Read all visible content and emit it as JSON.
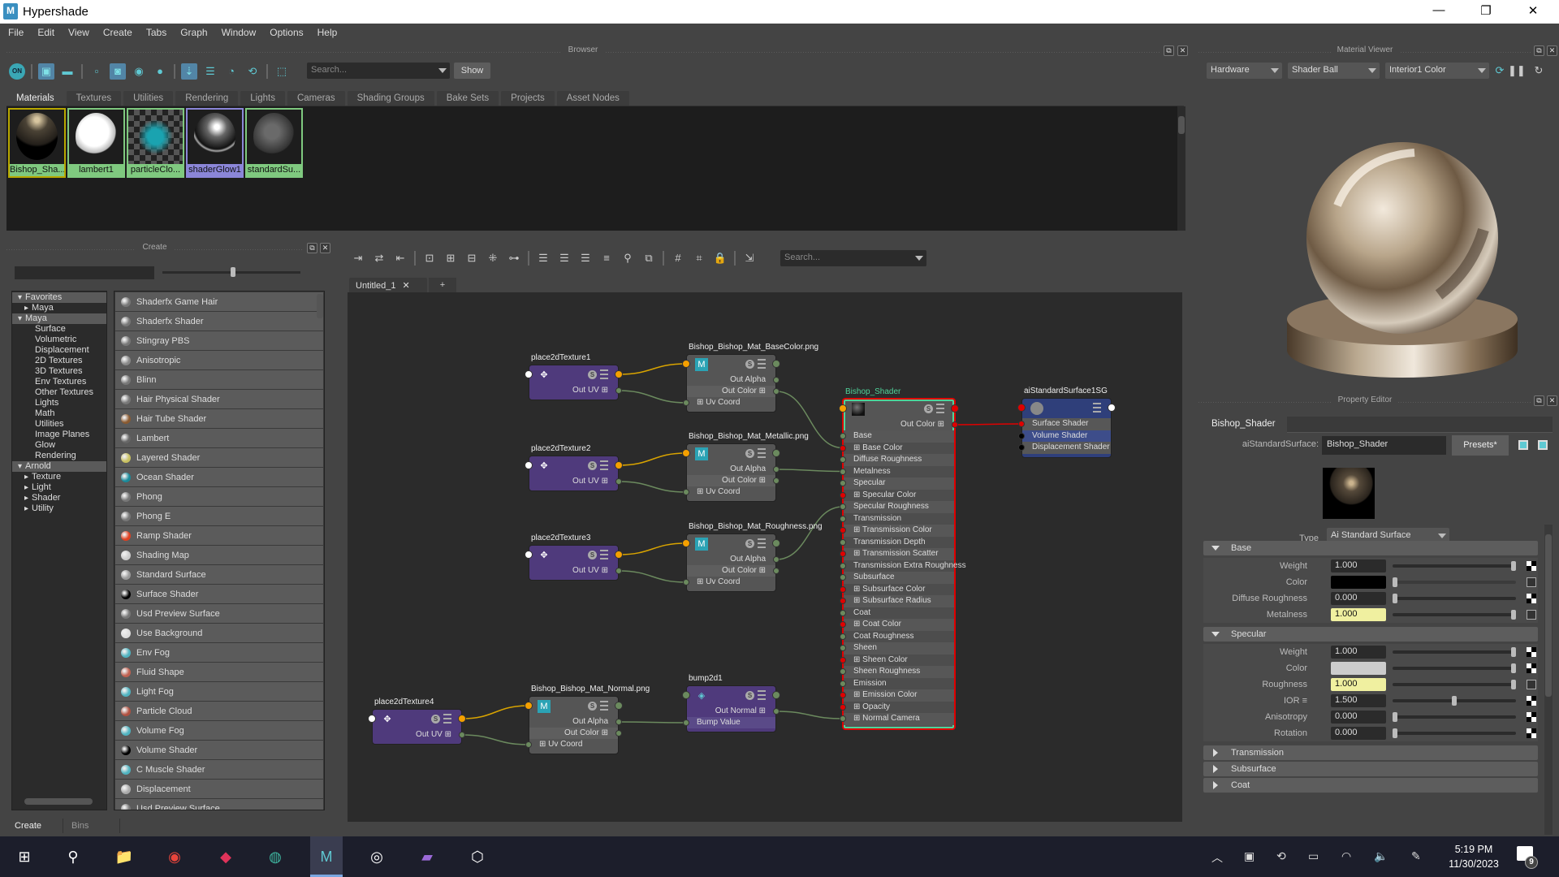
{
  "window": {
    "title": "Hypershade",
    "app_icon": "maya-logo-icon"
  },
  "menu": [
    "File",
    "Edit",
    "View",
    "Create",
    "Tabs",
    "Graph",
    "Window",
    "Options",
    "Help"
  ],
  "browser": {
    "title": "Browser",
    "search_placeholder": "Search...",
    "show_label": "Show",
    "toolbar_icons": [
      "on-toggle-icon",
      "sep",
      "swatch-view-icon",
      "list-view-icon",
      "sep",
      "small-icon-size",
      "medium-icon-size",
      "large-icon-size",
      "xlarge-icon-size",
      "sep",
      "sort-by-name-icon",
      "sort-by-type-icon",
      "sort-by-time-icon",
      "sort-reverse-icon",
      "sep",
      "frame-icon"
    ],
    "tabs": [
      "Materials",
      "Textures",
      "Utilities",
      "Rendering",
      "Lights",
      "Cameras",
      "Shading Groups",
      "Bake Sets",
      "Projects",
      "Asset Nodes"
    ],
    "active_tab": "Materials",
    "materials": [
      {
        "name": "Bishop_Sha...",
        "border": "#b8a800",
        "label_bg": "#7fc97f"
      },
      {
        "name": "lambert1",
        "border": "#7fc97f",
        "label_bg": "#7fc97f"
      },
      {
        "name": "particleClo...",
        "border": "#7fc97f",
        "label_bg": "#7fc97f"
      },
      {
        "name": "shaderGlow1",
        "border": "#8b86d8",
        "label_bg": "#8b86d8"
      },
      {
        "name": "standardSu...",
        "border": "#7fc97f",
        "label_bg": "#7fc97f"
      }
    ]
  },
  "material_viewer": {
    "title": "Material Viewer",
    "renderer": "Hardware",
    "geometry": "Shader Ball",
    "environment": "Interior1 Color"
  },
  "create": {
    "title": "Create",
    "tree": [
      {
        "label": "Favorites",
        "type": "header"
      },
      {
        "label": "Maya",
        "type": "collapsed"
      },
      {
        "label": "Maya",
        "type": "header"
      },
      {
        "label": "Surface",
        "type": "leaf"
      },
      {
        "label": "Volumetric",
        "type": "leaf"
      },
      {
        "label": "Displacement",
        "type": "leaf"
      },
      {
        "label": "2D Textures",
        "type": "leaf"
      },
      {
        "label": "3D Textures",
        "type": "leaf"
      },
      {
        "label": "Env Textures",
        "type": "leaf"
      },
      {
        "label": "Other Textures",
        "type": "leaf"
      },
      {
        "label": "Lights",
        "type": "leaf"
      },
      {
        "label": "Math",
        "type": "leaf"
      },
      {
        "label": "Utilities",
        "type": "leaf"
      },
      {
        "label": "Image Planes",
        "type": "leaf"
      },
      {
        "label": "Glow",
        "type": "leaf"
      },
      {
        "label": "Rendering",
        "type": "leaf"
      },
      {
        "label": "Arnold",
        "type": "header"
      },
      {
        "label": "Texture",
        "type": "collapsed"
      },
      {
        "label": "Light",
        "type": "collapsed"
      },
      {
        "label": "Shader",
        "type": "collapsed"
      },
      {
        "label": "Utility",
        "type": "collapsed"
      }
    ],
    "items": [
      {
        "label": "Shaderfx Game Hair",
        "color": "#777"
      },
      {
        "label": "Shaderfx Shader",
        "color": "#777"
      },
      {
        "label": "Stingray PBS",
        "color": "#777"
      },
      {
        "label": "Anisotropic",
        "color": "#888"
      },
      {
        "label": "Blinn",
        "color": "#777"
      },
      {
        "label": "Hair Physical Shader",
        "color": "#777"
      },
      {
        "label": "Hair Tube Shader",
        "color": "#8a5a30"
      },
      {
        "label": "Lambert",
        "color": "#666"
      },
      {
        "label": "Layered Shader",
        "color": "#c8c060"
      },
      {
        "label": "Ocean Shader",
        "color": "#1a8a9a"
      },
      {
        "label": "Phong",
        "color": "#777"
      },
      {
        "label": "Phong E",
        "color": "#777"
      },
      {
        "label": "Ramp Shader",
        "color": "#e04020"
      },
      {
        "label": "Shading Map",
        "color": "#ccc"
      },
      {
        "label": "Standard Surface",
        "color": "#999"
      },
      {
        "label": "Surface Shader",
        "color": "#000"
      },
      {
        "label": "Usd Preview Surface",
        "color": "#777"
      },
      {
        "label": "Use Background",
        "color": "#ddd"
      },
      {
        "label": "Env Fog",
        "color": "#4fb3c0"
      },
      {
        "label": "Fluid Shape",
        "color": "#c06050"
      },
      {
        "label": "Light Fog",
        "color": "#4fb3c0"
      },
      {
        "label": "Particle Cloud",
        "color": "#b05040"
      },
      {
        "label": "Volume Fog",
        "color": "#4fb3c0"
      },
      {
        "label": "Volume Shader",
        "color": "#000"
      },
      {
        "label": "C Muscle Shader",
        "color": "#4fb3c0"
      },
      {
        "label": "Displacement",
        "color": "#aaa"
      },
      {
        "label": "Usd Preview Surface",
        "color": "#777"
      }
    ],
    "bottom_tabs": [
      "Create",
      "Bins"
    ]
  },
  "graph": {
    "toolbar_icons": [
      "input-connections-icon",
      "input-output-connections-icon",
      "output-connections-icon",
      "sep",
      "graph-materials-icon",
      "add-selected-icon",
      "remove-selected-icon",
      "clear-graph-icon",
      "rearrange-icon",
      "sep",
      "simple-view-icon",
      "connected-view-icon",
      "full-view-icon",
      "custom-view-icon",
      "find-icon",
      "frame-selected-icon",
      "sep",
      "grid-icon",
      "snap-grid-icon",
      "lock-icon",
      "sep",
      "pin-icon"
    ],
    "search_placeholder": "Search...",
    "tab": "Untitled_1",
    "add_tab": "+",
    "nodes": {
      "p1": {
        "name": "place2dTexture1",
        "outputs": [
          "Out UV"
        ]
      },
      "p2": {
        "name": "place2dTexture2",
        "outputs": [
          "Out UV"
        ]
      },
      "p3": {
        "name": "place2dTexture3",
        "outputs": [
          "Out UV"
        ]
      },
      "p4": {
        "name": "place2dTexture4",
        "outputs": [
          "Out UV"
        ]
      },
      "f1": {
        "name": "Bishop_Bishop_Mat_BaseColor.png",
        "outputs": [
          "Out Alpha",
          "Out Color"
        ],
        "inputs": [
          "Uv Coord"
        ]
      },
      "f2": {
        "name": "Bishop_Bishop_Mat_Metallic.png",
        "outputs": [
          "Out Alpha",
          "Out Color"
        ],
        "inputs": [
          "Uv Coord"
        ]
      },
      "f3": {
        "name": "Bishop_Bishop_Mat_Roughness.png",
        "outputs": [
          "Out Alpha",
          "Out Color"
        ],
        "inputs": [
          "Uv Coord"
        ]
      },
      "f4": {
        "name": "Bishop_Bishop_Mat_Normal.png",
        "outputs": [
          "Out Alpha",
          "Out Color"
        ],
        "inputs": [
          "Uv Coord"
        ]
      },
      "b1": {
        "name": "bump2d1",
        "outputs": [
          "Out Normal"
        ],
        "inputs": [
          "Bump Value"
        ]
      },
      "sh": {
        "name": "Bishop_Shader",
        "outputs": [
          "Out Color"
        ],
        "inputs": [
          "Base",
          "Base Color",
          "Diffuse Roughness",
          "Metalness",
          "Specular",
          "Specular Color",
          "Specular Roughness",
          "Transmission",
          "Transmission Color",
          "Transmission Depth",
          "Transmission Scatter",
          "Transmission Extra Roughness",
          "Subsurface",
          "Subsurface Color",
          "Subsurface Radius",
          "Coat",
          "Coat Color",
          "Coat Roughness",
          "Sheen",
          "Sheen Color",
          "Sheen Roughness",
          "Emission",
          "Emission Color",
          "Opacity",
          "Normal Camera"
        ]
      },
      "sg": {
        "name": "aiStandardSurface1SG",
        "inputs": [
          "Surface Shader",
          "Volume Shader",
          "Displacement Shader"
        ]
      }
    }
  },
  "property_editor": {
    "title": "Property Editor",
    "tab": "Bishop_Shader",
    "node_type_label": "aiStandardSurface:",
    "node_name": "Bishop_Shader",
    "presets": "Presets*",
    "type_label": "Type",
    "type_value": "Ai Standard Surface",
    "sections": [
      {
        "title": "Base",
        "expanded": true,
        "attrs": [
          {
            "label": "Weight",
            "value": "1.000",
            "slider": 1.0
          },
          {
            "label": "Color",
            "swatch": "#000000",
            "slider": 0.0,
            "connected": true
          },
          {
            "label": "Diffuse Roughness",
            "value": "0.000",
            "slider": 0.0
          },
          {
            "label": "Metalness",
            "value": "1.000",
            "slider": 1.0,
            "connected": true
          }
        ]
      },
      {
        "title": "Specular",
        "expanded": true,
        "attrs": [
          {
            "label": "Weight",
            "value": "1.000",
            "slider": 1.0
          },
          {
            "label": "Color",
            "swatch": "#cccccc",
            "slider": 1.0
          },
          {
            "label": "Roughness",
            "value": "1.000",
            "slider": 1.0,
            "connected": true
          },
          {
            "label": "IOR ≡",
            "value": "1.500",
            "slider": 0.5
          },
          {
            "label": "Anisotropy",
            "value": "0.000",
            "slider": 0.0
          },
          {
            "label": "Rotation",
            "value": "0.000",
            "slider": 0.0
          }
        ]
      },
      {
        "title": "Transmission",
        "expanded": false
      },
      {
        "title": "Subsurface",
        "expanded": false
      },
      {
        "title": "Coat",
        "expanded": false
      }
    ]
  },
  "taskbar": {
    "apps": [
      "windows-start-icon",
      "search-icon",
      "file-explorer-icon",
      "chrome-icon",
      "red-app-icon",
      "green-app-icon",
      "maya-icon",
      "obs-icon",
      "clapper-icon",
      "unity-icon"
    ],
    "time": "5:19 PM",
    "date": "11/30/2023",
    "notifications": "9"
  }
}
